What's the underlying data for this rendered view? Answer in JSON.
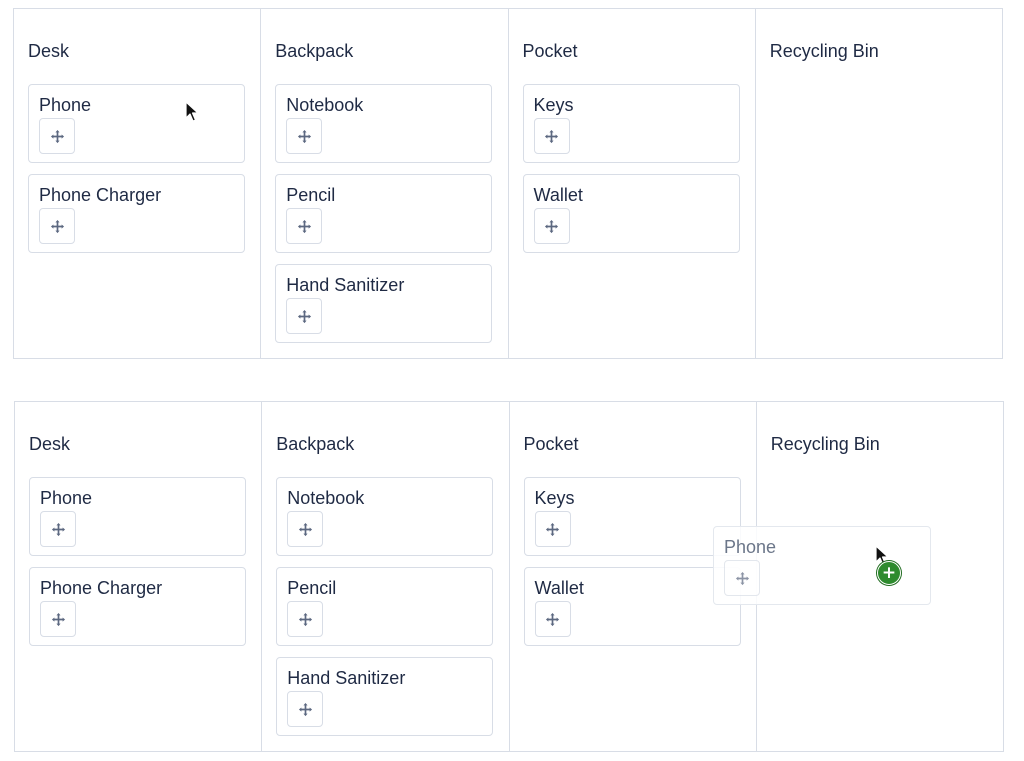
{
  "board_top": {
    "columns": [
      {
        "title": "Desk",
        "cards": [
          "Phone",
          "Phone Charger"
        ]
      },
      {
        "title": "Backpack",
        "cards": [
          "Notebook",
          "Pencil",
          "Hand Sanitizer"
        ]
      },
      {
        "title": "Pocket",
        "cards": [
          "Keys",
          "Wallet"
        ]
      },
      {
        "title": "Recycling Bin",
        "cards": []
      }
    ]
  },
  "board_bottom": {
    "columns": [
      {
        "title": "Desk",
        "cards": [
          "Phone",
          "Phone Charger"
        ]
      },
      {
        "title": "Backpack",
        "cards": [
          "Notebook",
          "Pencil",
          "Hand Sanitizer"
        ]
      },
      {
        "title": "Pocket",
        "cards": [
          "Keys",
          "Wallet"
        ]
      },
      {
        "title": "Recycling Bin",
        "cards": []
      }
    ],
    "drag_ghost": {
      "title": "Phone"
    }
  },
  "icons": {
    "drag_handle": "move-arrows-icon",
    "cursor": "mouse-pointer-icon",
    "drop_badge": "plus-circle-icon"
  },
  "colors": {
    "text": "#1f2a44",
    "border": "#d8dde6",
    "icon": "#5c6880",
    "drop_badge": "#2e8b2e"
  }
}
